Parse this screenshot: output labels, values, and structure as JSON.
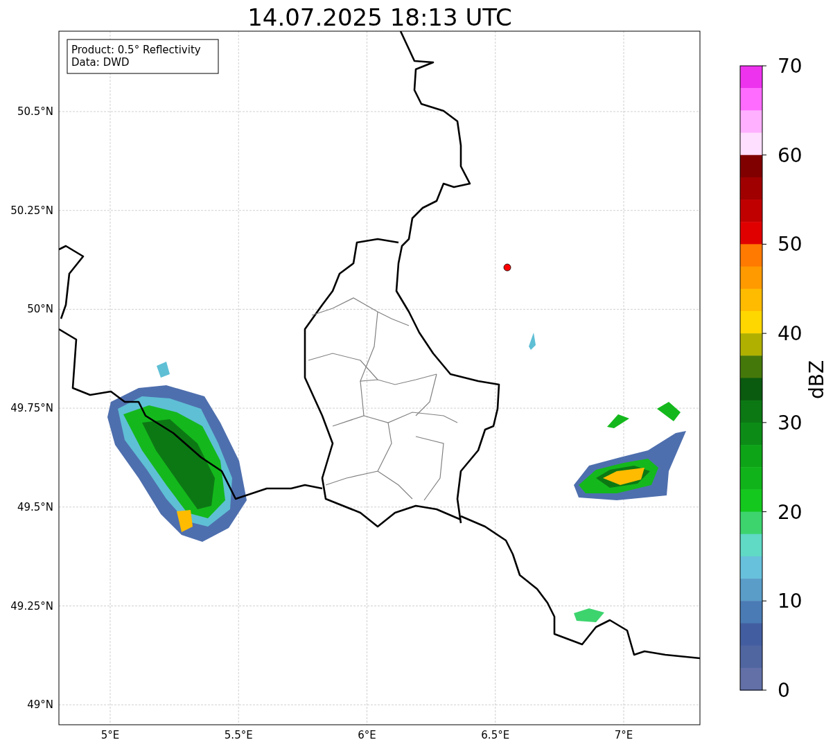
{
  "title": "14.07.2025 18:13 UTC",
  "map": {
    "legend": [
      "Product: 0.5° Reflectivity",
      "Data: DWD"
    ],
    "xticks": [
      "5°E",
      "5.5°E",
      "6°E",
      "6.5°E",
      "7°E"
    ],
    "yticks": [
      "50.5°N",
      "50.25°N",
      "50°N",
      "49.75°N",
      "49.5°N",
      "49.25°N",
      "49°N"
    ]
  },
  "colorbar": {
    "label": "dBZ",
    "ticks": [
      "70",
      "60",
      "50",
      "40",
      "30",
      "20",
      "10",
      "0"
    ],
    "bands": [
      {
        "color": "#ee33ee"
      },
      {
        "color": "#ff6cff"
      },
      {
        "color": "#ffb0ff"
      },
      {
        "color": "#ffdfff"
      },
      {
        "color": "#800000"
      },
      {
        "color": "#a00000"
      },
      {
        "color": "#c00000"
      },
      {
        "color": "#e00000"
      },
      {
        "color": "#ff7a00"
      },
      {
        "color": "#ff9a00"
      },
      {
        "color": "#ffbb00"
      },
      {
        "color": "#ffd700"
      },
      {
        "color": "#b0b000"
      },
      {
        "color": "#45780a"
      },
      {
        "color": "#0a5a10"
      },
      {
        "color": "#0c7814"
      },
      {
        "color": "#0c8c16"
      },
      {
        "color": "#0ea418"
      },
      {
        "color": "#10b41a"
      },
      {
        "color": "#14c81e"
      },
      {
        "color": "#3dd46e"
      },
      {
        "color": "#60d9c5"
      },
      {
        "color": "#68c1dc"
      },
      {
        "color": "#5a9dc8"
      },
      {
        "color": "#4a7bb4"
      },
      {
        "color": "#435ea0"
      },
      {
        "color": "#5066a1"
      },
      {
        "color": "#6270a7"
      }
    ]
  }
}
